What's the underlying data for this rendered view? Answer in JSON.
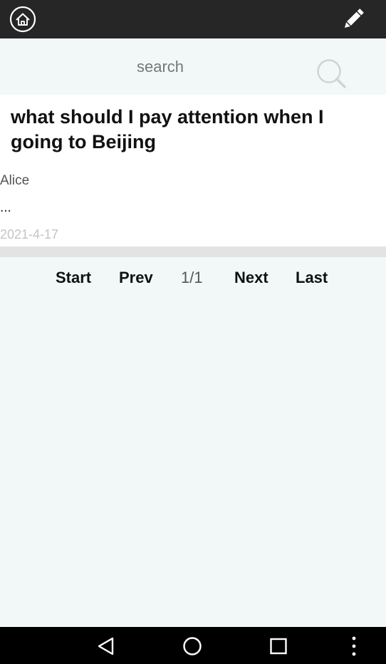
{
  "topbar": {
    "home_icon": "home-icon",
    "edit_icon": "pencil-icon"
  },
  "search": {
    "placeholder": "search",
    "icon": "search-icon"
  },
  "post": {
    "title": "what should I pay attention when I going to Beijing",
    "author": "Alice",
    "excerpt": "...",
    "date": "2021-4-17"
  },
  "pager": {
    "start": "Start",
    "prev": "Prev",
    "page_indicator": "1/1",
    "next": "Next",
    "last": "Last"
  },
  "navbar": {
    "back_icon": "back-triangle-icon",
    "home_icon": "home-circle-icon",
    "recents_icon": "recents-square-icon",
    "menu_icon": "more-vertical-icon"
  },
  "colors": {
    "topbar": "#262626",
    "background": "#f2f8f8",
    "card": "#ffffff",
    "divider": "#e3e3e3",
    "navbar": "#000000"
  }
}
